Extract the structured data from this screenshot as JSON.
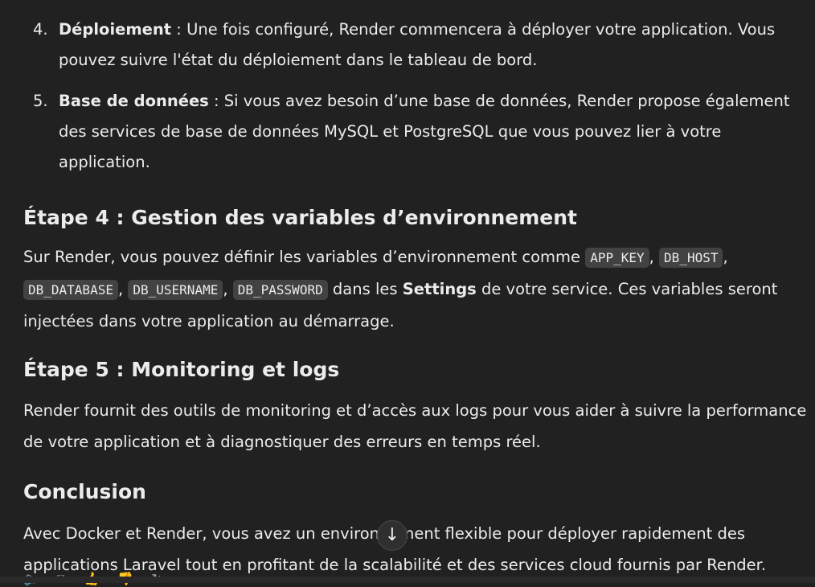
{
  "list": [
    {
      "num": "4.",
      "bold": "Déploiement",
      "text": " : Une fois configuré, Render commencera à déployer votre application. Vous pouvez suivre l'état du déploiement dans le tableau de bord."
    },
    {
      "num": "5.",
      "bold": "Base de données",
      "text": " : Si vous avez besoin d’une base de données, Render propose également des services de base de données MySQL et PostgreSQL que vous pouvez lier à votre application."
    }
  ],
  "step4": {
    "title": "Étape 4 : Gestion des variables d’environnement",
    "p1": "Sur Render, vous pouvez définir les variables d’environnement comme ",
    "codes": [
      "APP_KEY",
      "DB_HOST",
      "DB_DATABASE",
      "DB_USERNAME",
      "DB_PASSWORD"
    ],
    "sep": ", ",
    "p2": " dans les ",
    "bold": "Settings",
    "p3": " de votre service. Ces variables seront injectées dans votre application au démarrage."
  },
  "step5": {
    "title": "Étape 5 : Monitoring et logs",
    "text": "Render fournit des outils de monitoring et d’accès aux logs pour vous aider à suivre la performance de votre application et à diagnostiquer des erreurs en temps réel."
  },
  "conclusion": {
    "title": "Conclusion",
    "text": "Avec Docker et Render, vous avez un environnement flexible pour déployer rapidement des applications Laravel tout en profitant de la scalabilité et des services cloud fournis par Render."
  },
  "scroll_down_glyph": "↓",
  "icons": [
    "speaker-icon",
    "copy-icon",
    "thumbs-up-icon",
    "thumbs-down-icon",
    "regenerate-icon"
  ]
}
